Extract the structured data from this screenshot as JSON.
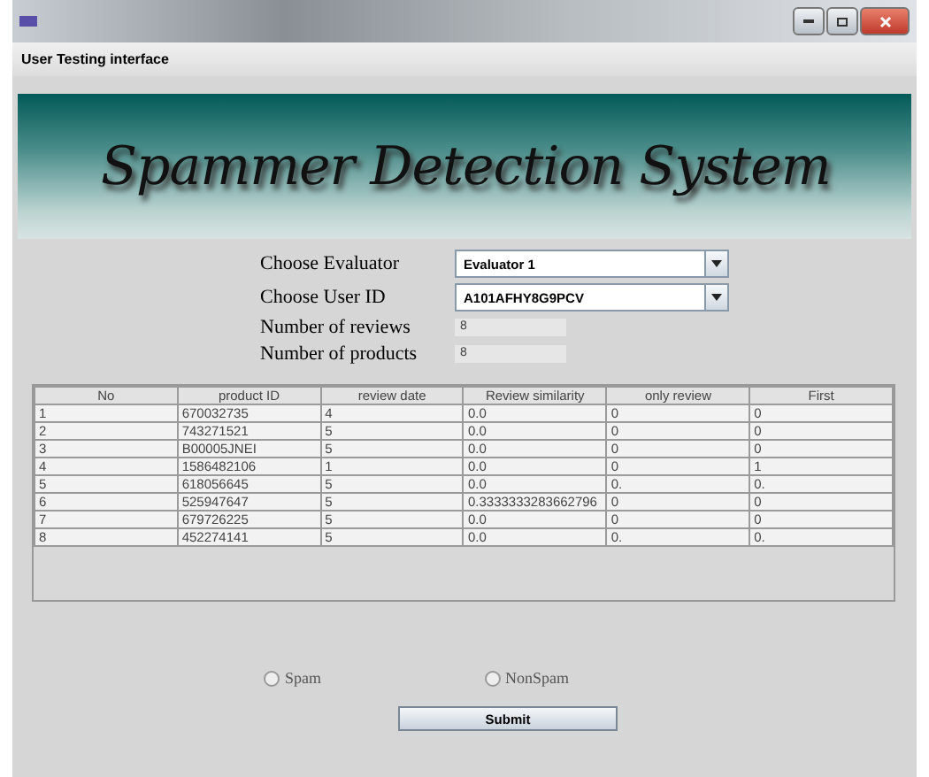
{
  "window": {
    "subtitle": "User Testing interface"
  },
  "banner": {
    "title": "Spammer Detection System"
  },
  "form": {
    "evaluator": {
      "label": "Choose Evaluator",
      "value": "Evaluator 1"
    },
    "user_id": {
      "label": "Choose User ID",
      "value": "A101AFHY8G9PCV"
    },
    "reviews": {
      "label": "Number of reviews",
      "value": "8"
    },
    "products": {
      "label": "Number of products",
      "value": "8"
    }
  },
  "table": {
    "columns": [
      "No",
      "product ID",
      "review date",
      "Review similarity",
      "only review",
      "First"
    ],
    "rows": [
      [
        "1",
        "670032735",
        "4",
        "0.0",
        "0",
        "0"
      ],
      [
        "2",
        "743271521",
        "5",
        "0.0",
        "0",
        "0"
      ],
      [
        "3",
        "B00005JNEI",
        "5",
        "0.0",
        "0",
        "0"
      ],
      [
        "4",
        "1586482106",
        "1",
        "0.0",
        "0",
        "1"
      ],
      [
        "5",
        "618056645",
        "5",
        "0.0",
        "0.",
        "0."
      ],
      [
        "6",
        "525947647",
        "5",
        "0.3333333283662796",
        "0",
        "0"
      ],
      [
        "7",
        "679726225",
        "5",
        "0.0",
        "0",
        "0"
      ],
      [
        "8",
        "452274141",
        "5",
        "0.0",
        "0.",
        "0."
      ]
    ]
  },
  "radios": [
    {
      "label": "Spam",
      "selected": false
    },
    {
      "label": "NonSpam",
      "selected": false
    }
  ],
  "submit": "Submit"
}
